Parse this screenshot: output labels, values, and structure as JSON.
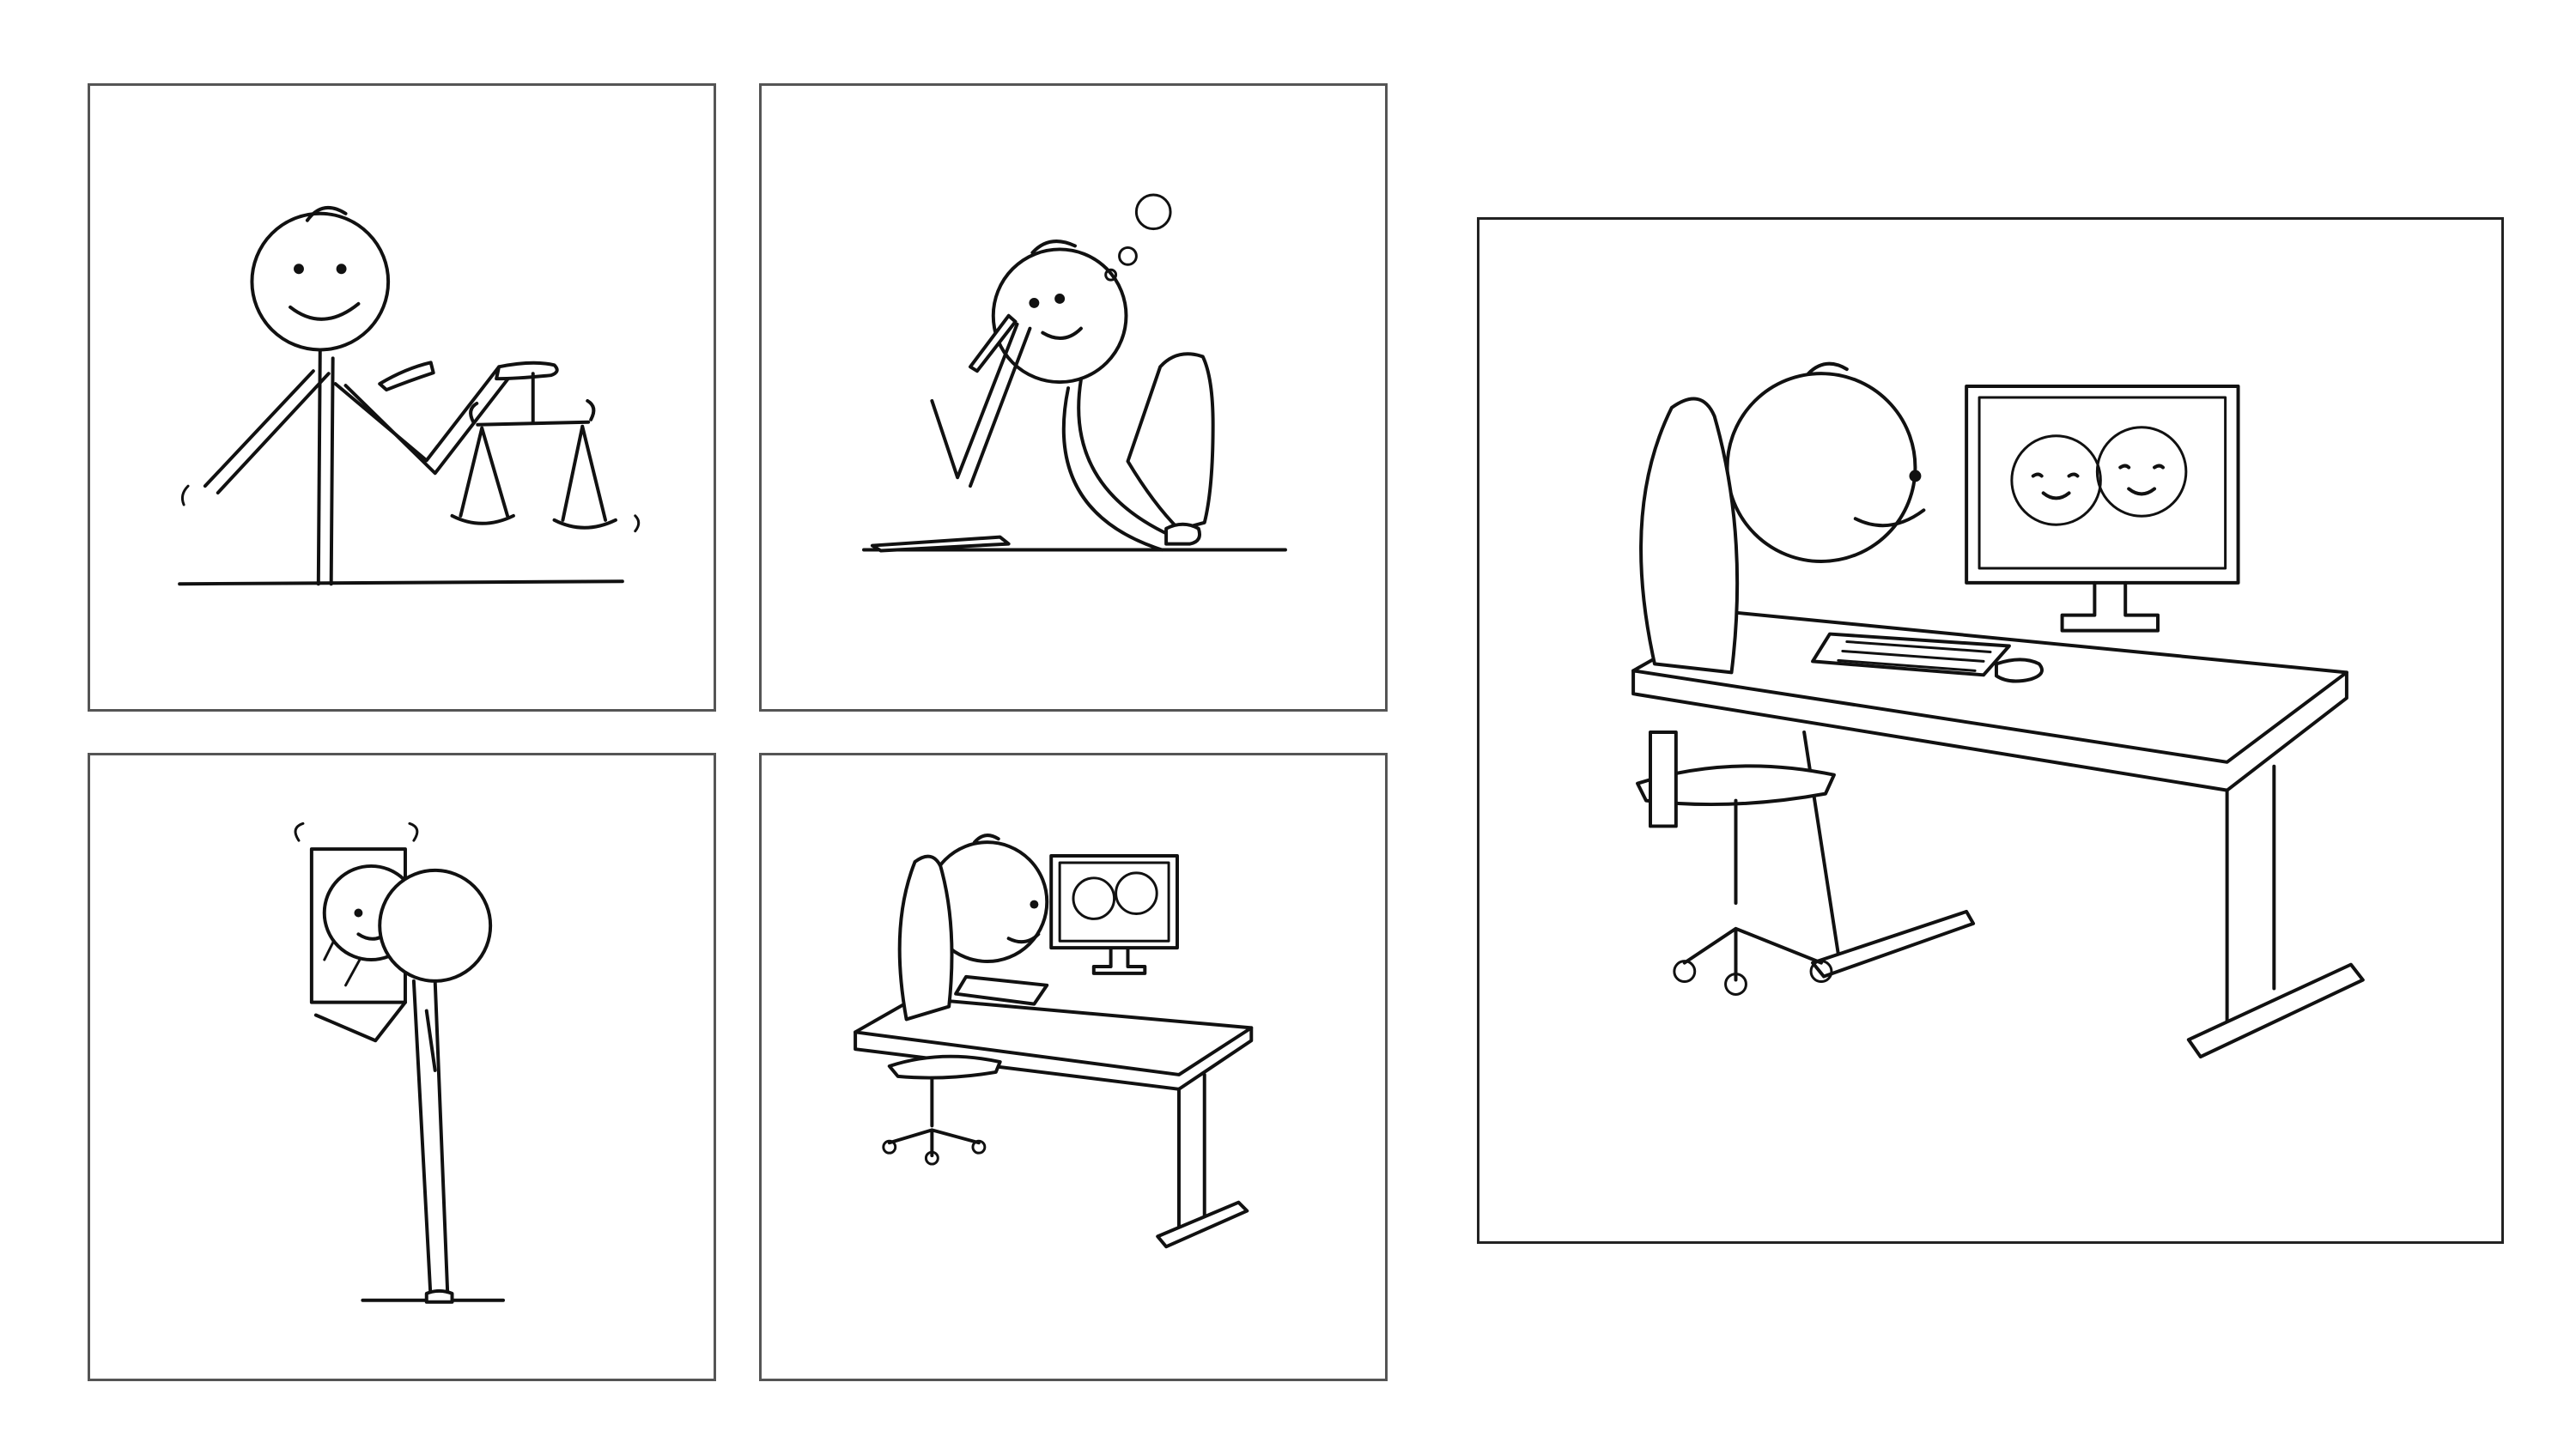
{
  "panels": [
    {
      "scene": "stick-figure-pointing-at-balance-scale"
    },
    {
      "scene": "stick-figure-thinking-with-pen"
    },
    {
      "scene": "stick-figure-looking-in-mirror"
    },
    {
      "scene": "stick-figure-video-call-at-desk"
    },
    {
      "scene": "stick-figure-video-call-at-desk-large"
    }
  ],
  "colors": {
    "background": "#ffffff",
    "ink": "#111111",
    "frame": "#555555"
  }
}
